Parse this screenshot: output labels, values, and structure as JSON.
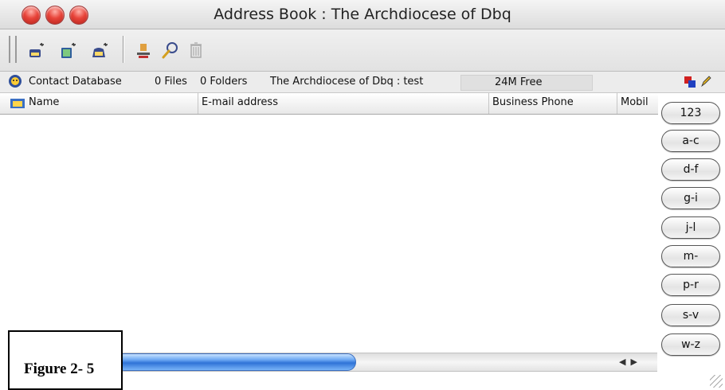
{
  "window": {
    "title": "Address Book : The Archdiocese of Dbq"
  },
  "status": {
    "database_label": "Contact Database",
    "files": "0 Files",
    "folders": "0 Folders",
    "path": "The Archdiocese of Dbq : test",
    "free": "24M Free"
  },
  "columns": [
    "Name",
    "E-mail address",
    "Business Phone",
    "Mobil"
  ],
  "index_buttons": [
    "123",
    "a-c",
    "d-f",
    "g-i",
    "j-l",
    "m-",
    "p-r",
    "s-v",
    "w-z"
  ],
  "caption": "Figure 2- 5",
  "colors": {
    "accent": "#2f73d7",
    "close": "#e8443a"
  },
  "icons": [
    "new-contact-icon",
    "new-group-icon",
    "new-list-icon",
    "user-icon",
    "search-icon",
    "trash-icon",
    "database-icon",
    "windows-icon",
    "pencil-icon",
    "folder-icon"
  ]
}
